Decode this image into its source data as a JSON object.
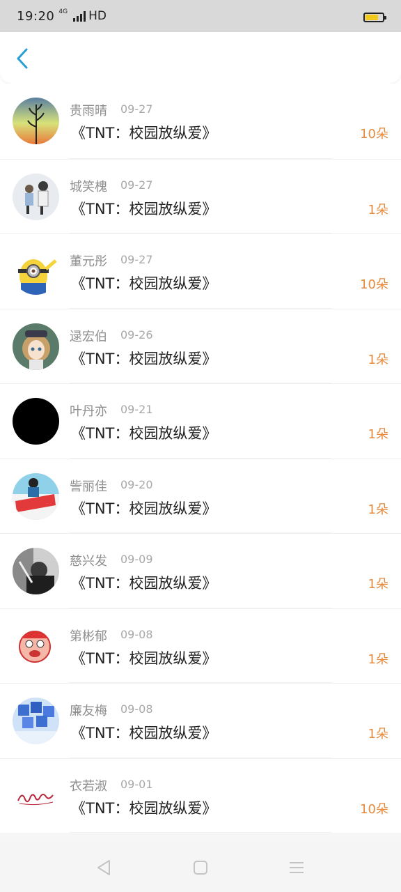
{
  "status_bar": {
    "time": "19:20",
    "net_type": "4G",
    "hd": "HD",
    "battery_color": "#f0c91a"
  },
  "header": {
    "back_icon": "chevron-left-icon",
    "accent": "#2a9fd6"
  },
  "items": [
    {
      "name": "贵雨晴",
      "date": "09-27",
      "title": "《TNT：校园放纵爱》",
      "count": "10朵",
      "avatar": "plant-sunset"
    },
    {
      "name": "城笑槐",
      "date": "09-27",
      "title": "《TNT：校园放纵爱》",
      "count": "1朵",
      "avatar": "two-kids"
    },
    {
      "name": "董元彤",
      "date": "09-27",
      "title": "《TNT：校园放纵爱》",
      "count": "10朵",
      "avatar": "minion"
    },
    {
      "name": "逯宏伯",
      "date": "09-26",
      "title": "《TNT：校园放纵爱》",
      "count": "1朵",
      "avatar": "anime-girl"
    },
    {
      "name": "叶丹亦",
      "date": "09-21",
      "title": "《TNT：校园放纵爱》",
      "count": "1朵",
      "avatar": "black"
    },
    {
      "name": "訾丽佳",
      "date": "09-20",
      "title": "《TNT：校园放纵爱》",
      "count": "1朵",
      "avatar": "girl-red-banner"
    },
    {
      "name": "慈兴发",
      "date": "09-09",
      "title": "《TNT：校园放纵爱》",
      "count": "1朵",
      "avatar": "bw-portrait"
    },
    {
      "name": "第彬郁",
      "date": "09-08",
      "title": "《TNT：校园放纵爱》",
      "count": "1朵",
      "avatar": "cartoon-face"
    },
    {
      "name": "廉友梅",
      "date": "09-08",
      "title": "《TNT：校园放纵爱》",
      "count": "1朵",
      "avatar": "blue-cubes"
    },
    {
      "name": "衣若淑",
      "date": "09-01",
      "title": "《TNT：校园放纵爱》",
      "count": "10朵",
      "avatar": "script-logo"
    }
  ],
  "colors": {
    "count": "#e6893a",
    "name": "#8e8e8e",
    "date": "#a8a8a8"
  },
  "nav_bar": {
    "back_icon": "triangle-back-icon",
    "home_icon": "square-home-icon",
    "menu_icon": "menu-lines-icon"
  }
}
